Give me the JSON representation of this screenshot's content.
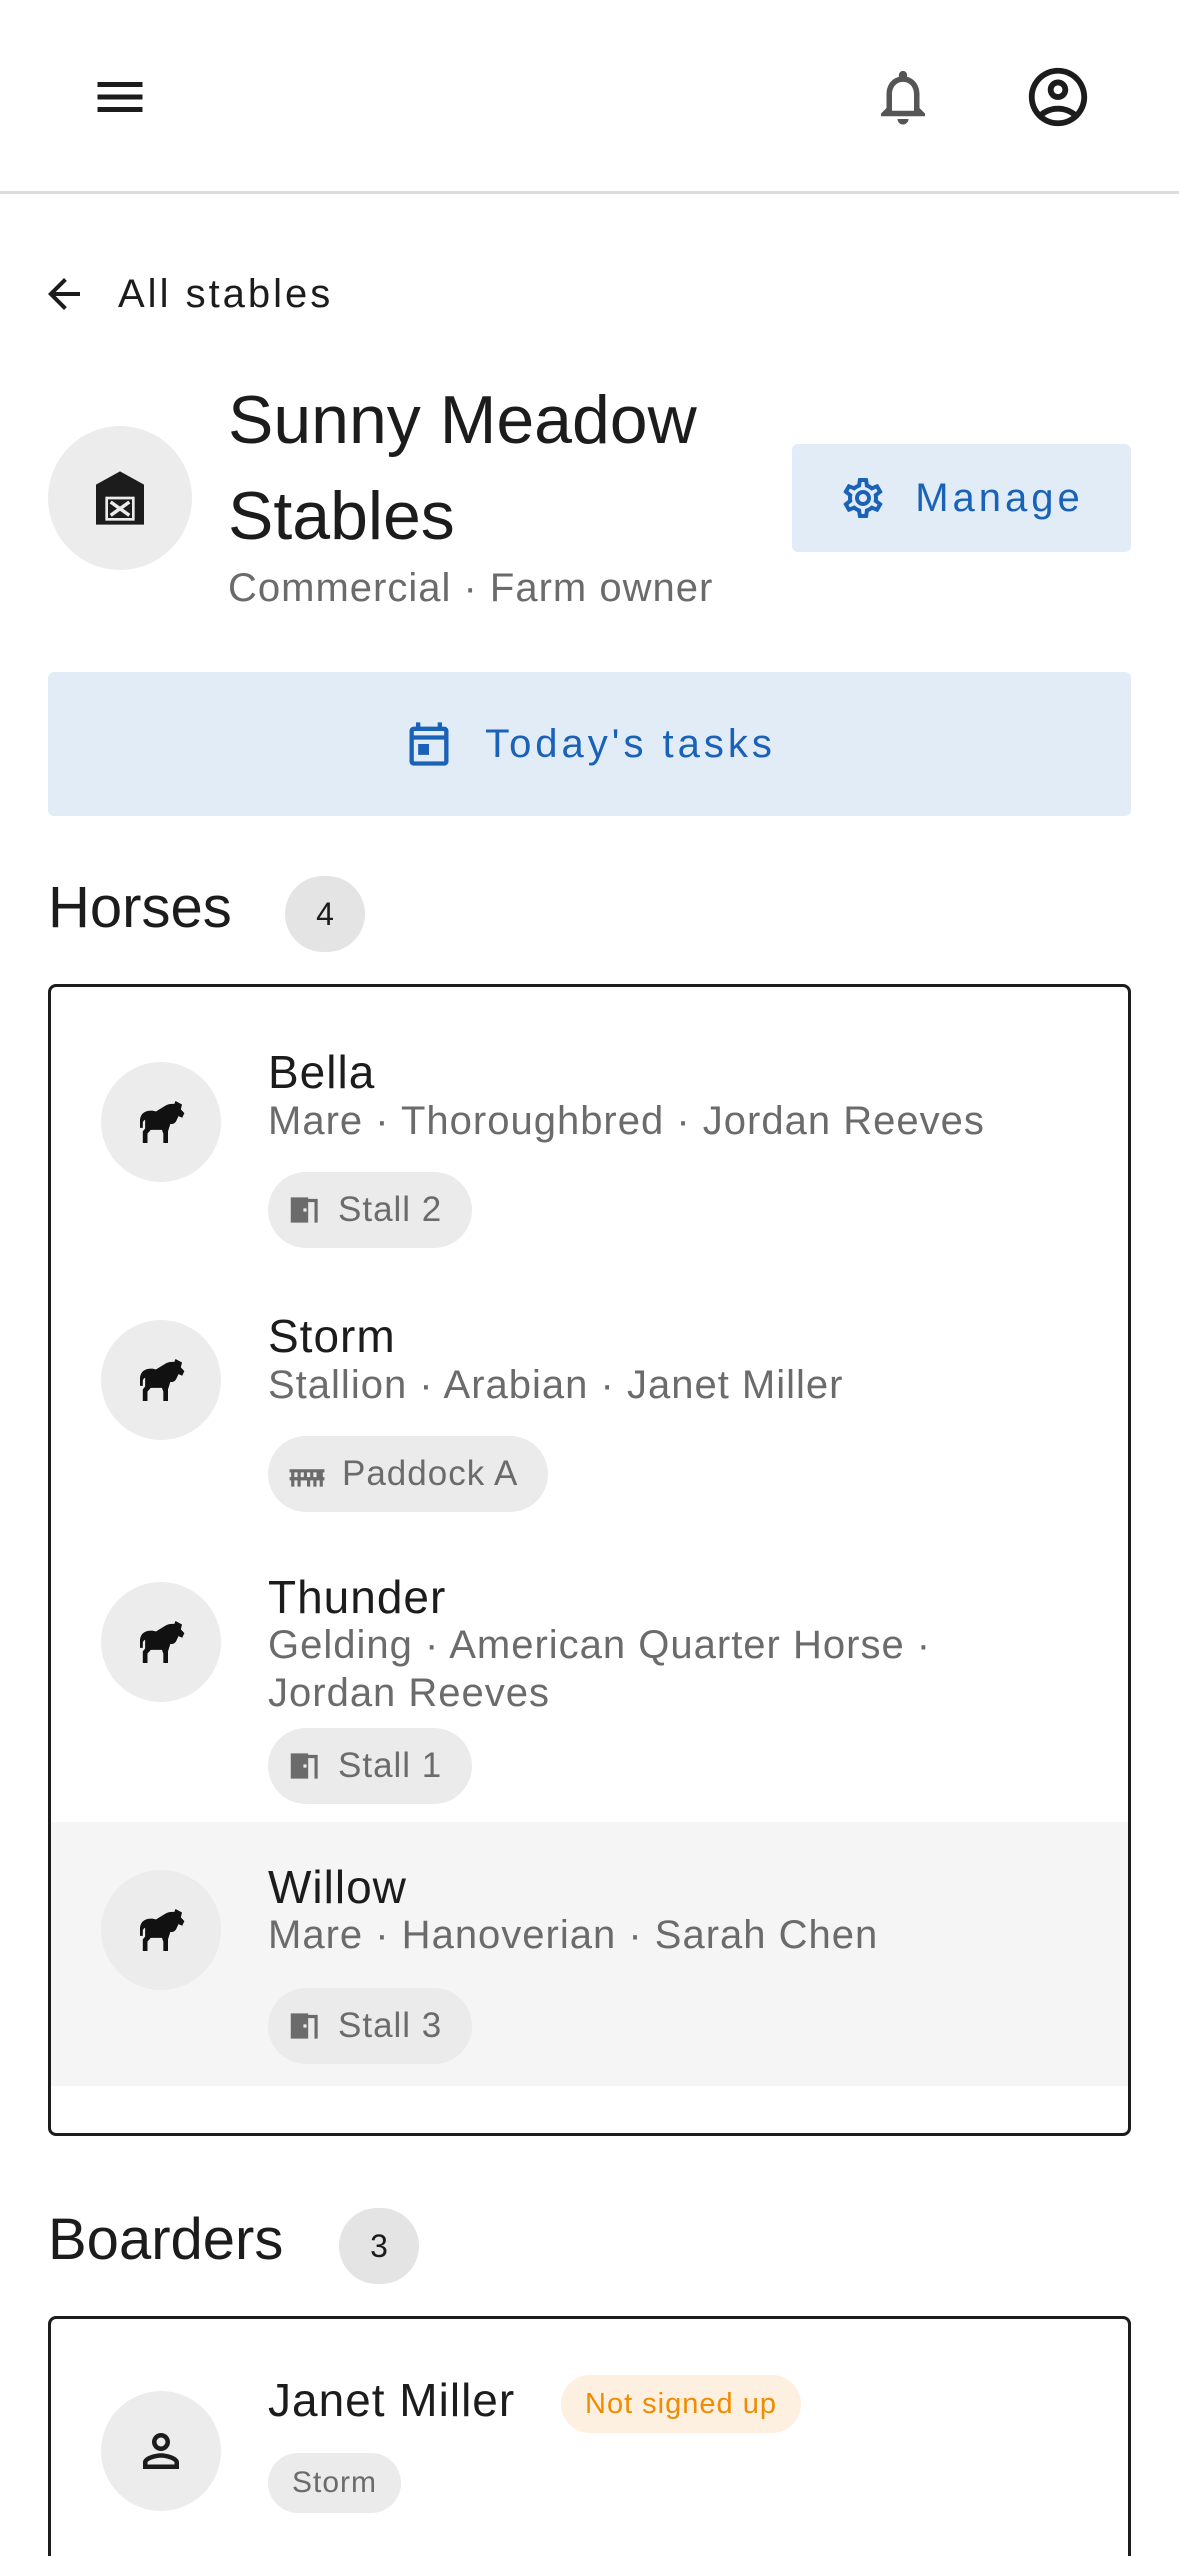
{
  "header": {
    "menu_icon": "menu-icon",
    "bell_icon": "bell-icon",
    "account_icon": "account-circle-icon"
  },
  "back": {
    "label": "All stables",
    "icon": "arrow-left-icon"
  },
  "stable": {
    "name": "Sunny Meadow Stables",
    "subtitle": "Commercial · Farm owner",
    "icon": "barn-icon",
    "manage_label": "Manage",
    "manage_icon": "gear-icon"
  },
  "tasks": {
    "label": "Today's tasks",
    "icon": "calendar-icon"
  },
  "colors": {
    "accent": "#1a62b8",
    "accent_bg": "#e2ecf7",
    "warning_text": "#ef8c00",
    "warning_bg": "#fdf0e0",
    "muted_text": "#6b6b6b"
  },
  "horses": {
    "title": "Horses",
    "count": "4",
    "items": [
      {
        "name": "Bella",
        "meta": "Mare · Thoroughbred · Jordan Reeves",
        "location": "Stall 2",
        "location_icon": "stall-icon"
      },
      {
        "name": "Storm",
        "meta": "Stallion · Arabian · Janet Miller",
        "location": "Paddock A",
        "location_icon": "fence-icon"
      },
      {
        "name": "Thunder",
        "meta": "Gelding · American Quarter Horse · Jordan Reeves",
        "location": "Stall 1",
        "location_icon": "stall-icon"
      },
      {
        "name": "Willow",
        "meta": "Mare · Hanoverian · Sarah Chen",
        "location": "Stall 3",
        "location_icon": "stall-icon"
      }
    ]
  },
  "boarders": {
    "title": "Boarders",
    "count": "3",
    "items": [
      {
        "name": "Janet Miller",
        "status": "Not signed up",
        "horse": "Storm",
        "icon": "person-icon"
      }
    ]
  }
}
